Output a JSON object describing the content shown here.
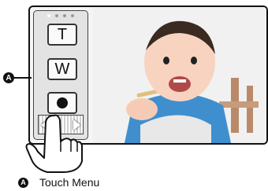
{
  "touch_menu": {
    "tele_label": "T",
    "wide_label": "W",
    "record_icon": "record-icon",
    "page_dots": 4,
    "active_page": 1,
    "scroll_left_icon": "arrow-left-icon",
    "scroll_right_icon": "arrow-right-icon"
  },
  "callout": {
    "marker": "A"
  },
  "legend": {
    "marker": "A",
    "text": "Touch Menu"
  },
  "colors": {
    "panel_bg": "#e3e3e3",
    "button_bg": "#fafafa",
    "outline": "#111111"
  }
}
